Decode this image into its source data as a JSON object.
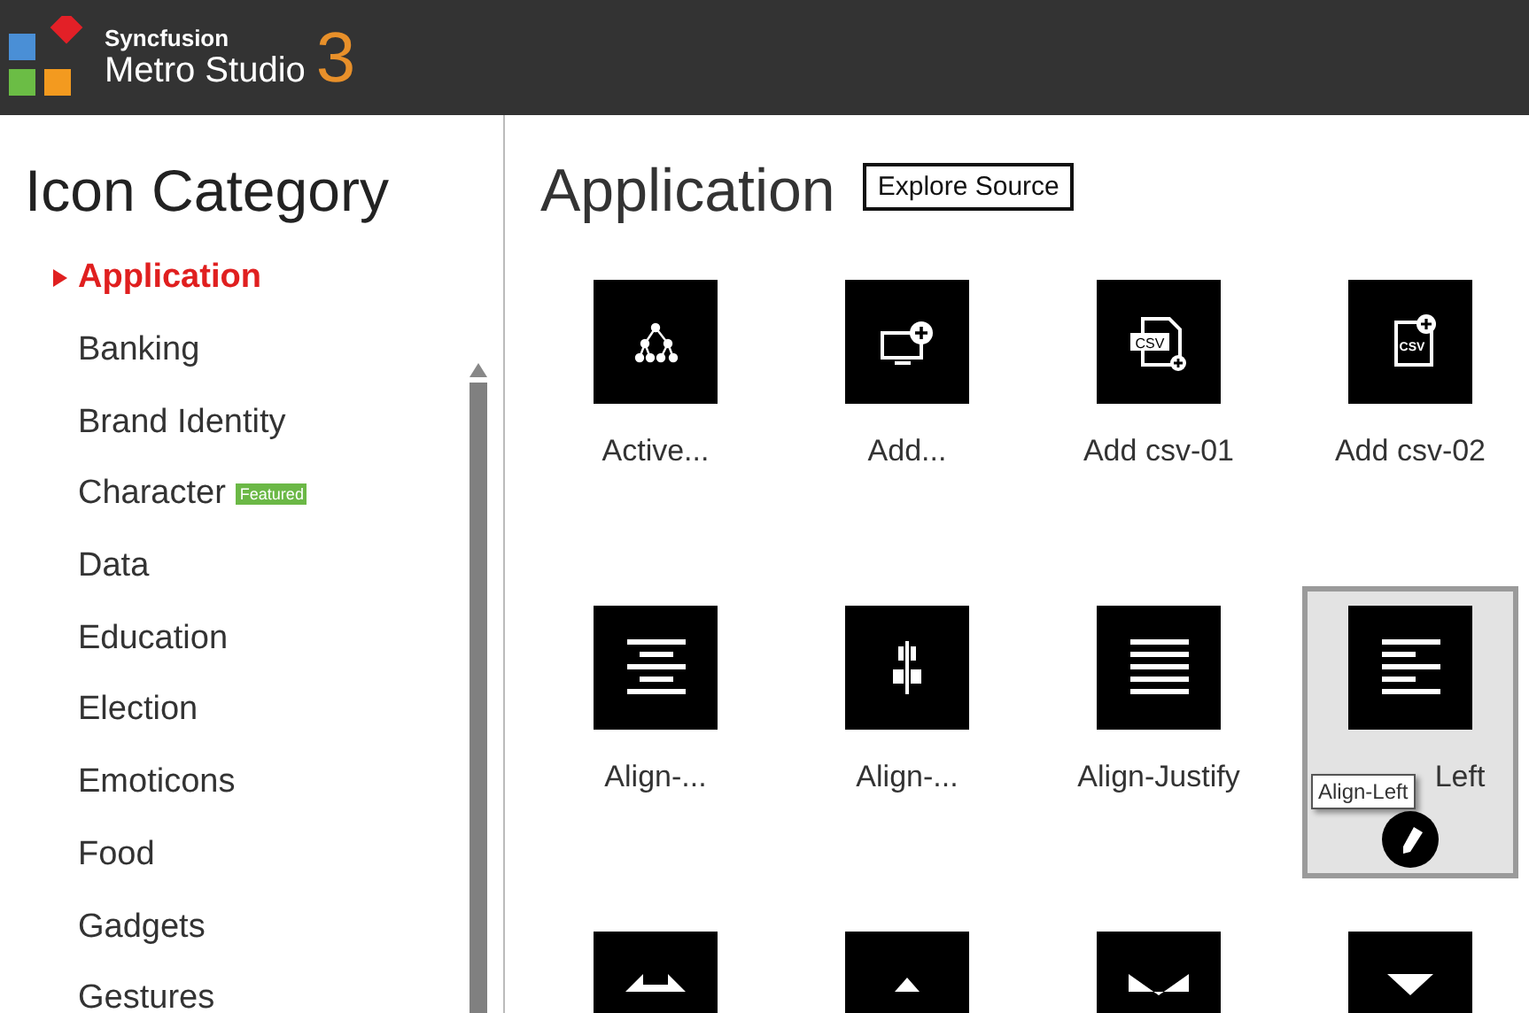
{
  "header": {
    "brand": "Syncfusion",
    "product": "Metro Studio",
    "version": "3"
  },
  "sidebar": {
    "title": "Icon Category",
    "items": [
      {
        "label": "Application",
        "selected": true
      },
      {
        "label": "Banking",
        "selected": false
      },
      {
        "label": "Brand Identity",
        "selected": false
      },
      {
        "label": "Character",
        "selected": false,
        "badge": "Featured"
      },
      {
        "label": "Data",
        "selected": false
      },
      {
        "label": "Education",
        "selected": false
      },
      {
        "label": "Election",
        "selected": false
      },
      {
        "label": "Emoticons",
        "selected": false
      },
      {
        "label": "Food",
        "selected": false
      },
      {
        "label": "Gadgets",
        "selected": false
      },
      {
        "label": "Gestures",
        "selected": false
      }
    ]
  },
  "gallery": {
    "title": "Application",
    "explore_button": "Explore Source",
    "tiles": [
      {
        "label": "Active...",
        "selected": false
      },
      {
        "label": "Add...",
        "selected": false
      },
      {
        "label": "Add csv-01",
        "selected": false,
        "icon_text": "CSV"
      },
      {
        "label": "Add csv-02",
        "selected": false,
        "icon_text": "CSV"
      },
      {
        "label": "Align-...",
        "selected": false
      },
      {
        "label": "Align-...",
        "selected": false
      },
      {
        "label": "Align-Justify",
        "selected": false
      },
      {
        "label": "Left",
        "selected": true,
        "tooltip": "Align-Left"
      },
      {
        "selected": false
      },
      {
        "selected": false
      },
      {
        "selected": false
      },
      {
        "selected": false
      }
    ]
  }
}
